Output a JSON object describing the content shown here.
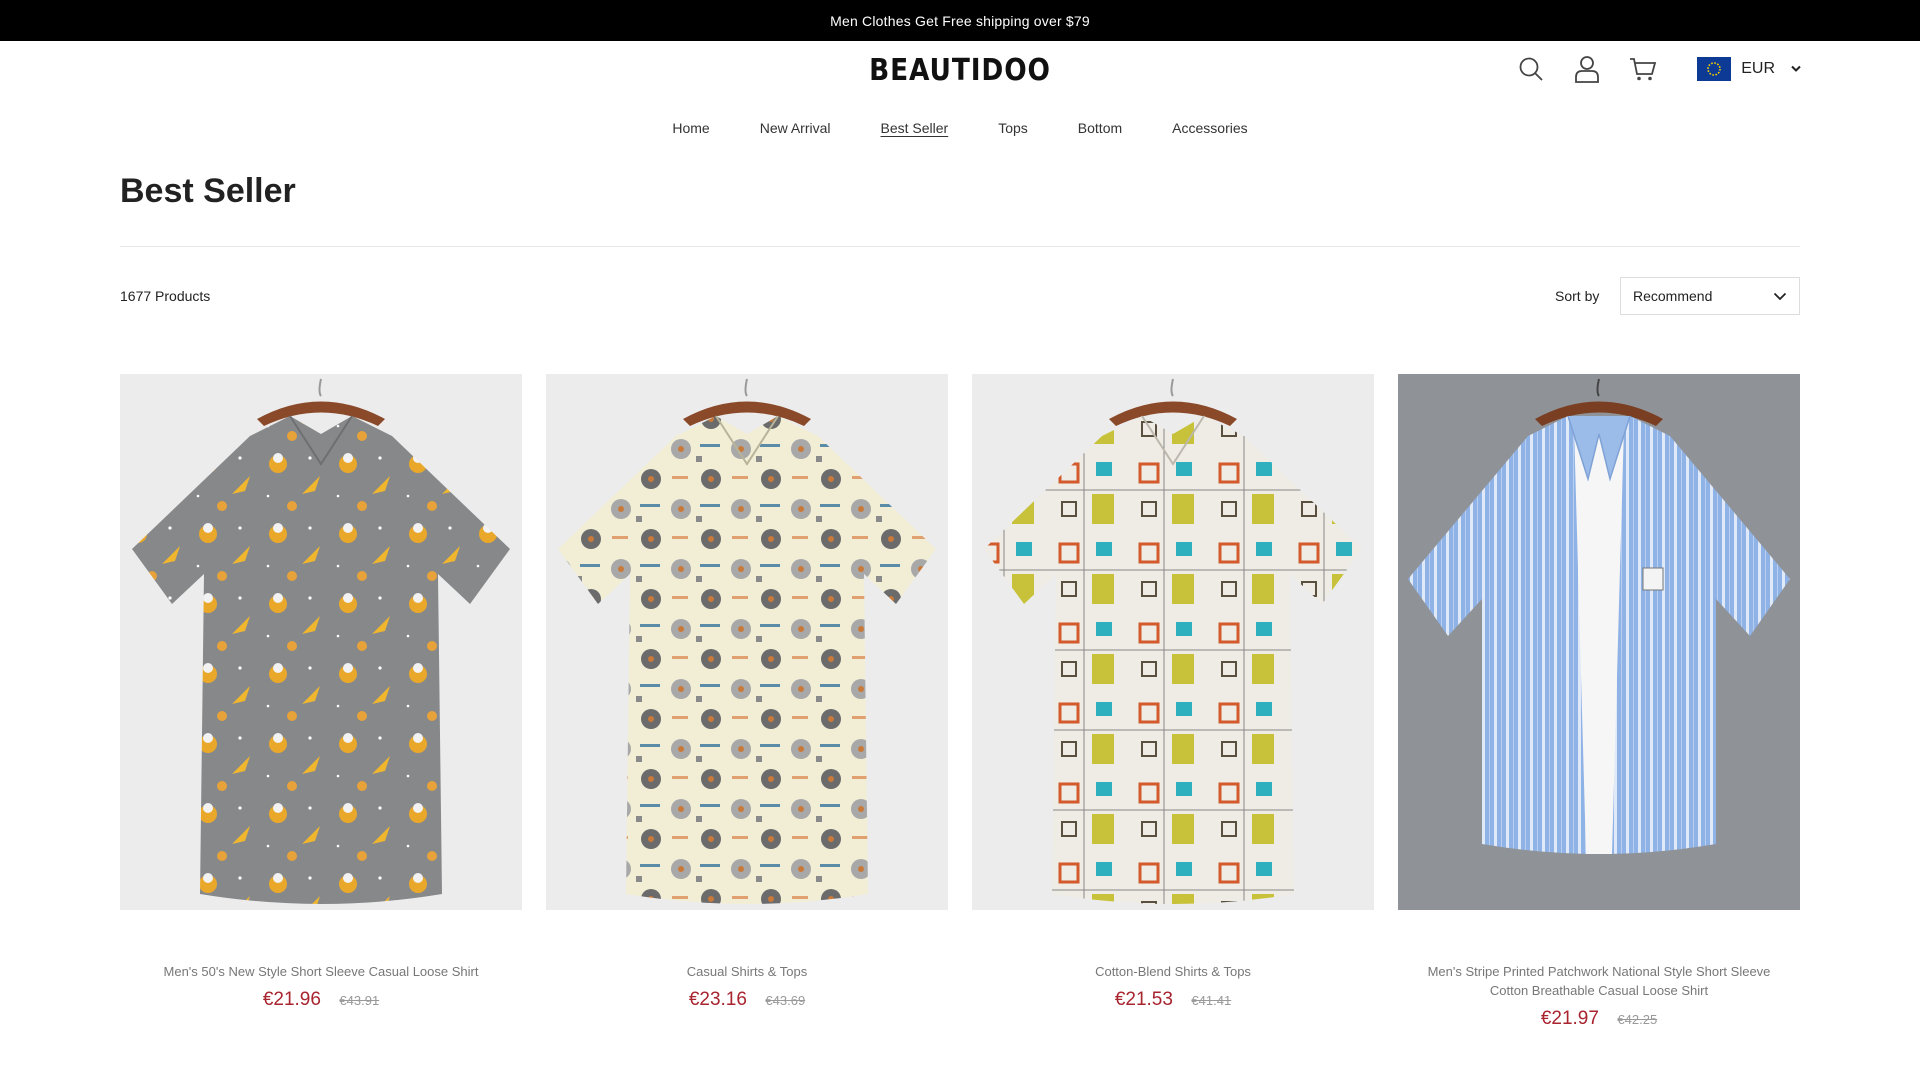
{
  "announcement": "Men Clothes Get Free shipping over $79",
  "brand": "BEAUTIDOO",
  "header": {
    "icons": [
      "search-icon",
      "user-icon",
      "cart-icon"
    ],
    "currency": "EUR"
  },
  "nav": {
    "items": [
      {
        "label": "Home"
      },
      {
        "label": "New Arrival"
      },
      {
        "label": "Best Seller",
        "active": true
      },
      {
        "label": "Tops"
      },
      {
        "label": "Bottom"
      },
      {
        "label": "Accessories"
      }
    ]
  },
  "page": {
    "title": "Best Seller",
    "count": "1677 Products",
    "sort_label": "Sort by",
    "sort_value": "Recommend"
  },
  "colors": {
    "price": "#a8242f",
    "announcement_bg": "#000000",
    "flag": "#0d3a94"
  },
  "products": [
    {
      "name": "Men's 50's New Style Short Sleeve Casual Loose Shirt",
      "price": "€21.96",
      "original_price": "€43.91"
    },
    {
      "name": "Casual Shirts & Tops",
      "price": "€23.16",
      "original_price": "€43.69"
    },
    {
      "name": "Cotton-Blend Shirts & Tops",
      "price": "€21.53",
      "original_price": "€41.41"
    },
    {
      "name": "Men's Stripe Printed Patchwork National Style Short Sleeve Cotton Breathable Casual Loose Shirt",
      "price": "€21.97",
      "original_price": "€42.25"
    }
  ]
}
